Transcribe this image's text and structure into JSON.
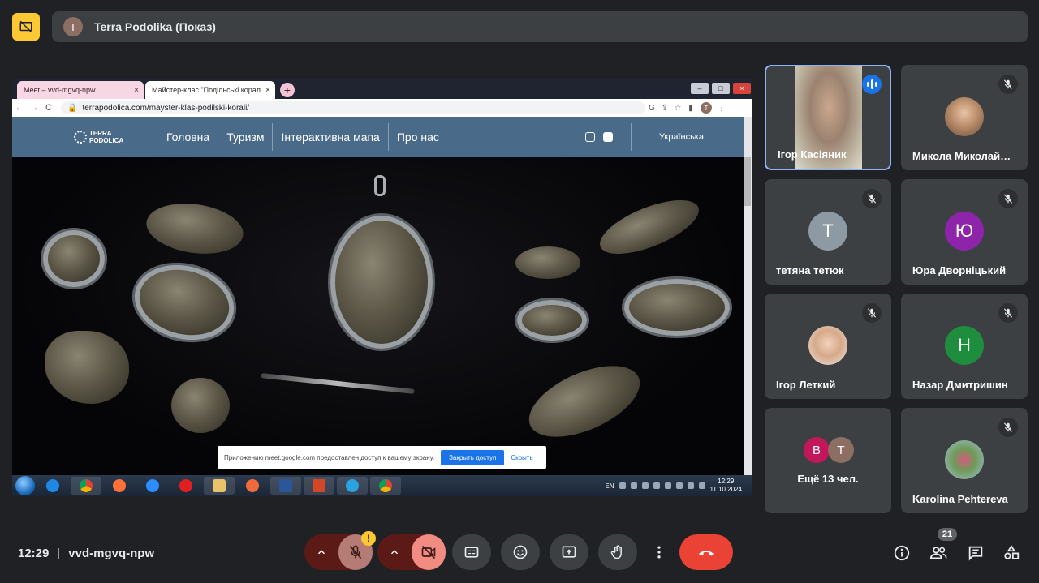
{
  "presenter_bar": {
    "avatar_letter": "T",
    "title": "Terra Podolika (Показ)"
  },
  "shared_screen": {
    "tabs": [
      {
        "label": "Meet – vvd-mgvq-npw",
        "close": "×"
      },
      {
        "label": "Майстер-клас \"Подільські корал",
        "close": "×"
      }
    ],
    "new_tab": "+",
    "window_controls": [
      "–",
      "□",
      "×"
    ],
    "nav_back": "←",
    "nav_forward": "→",
    "nav_reload": "C",
    "url": "terrapodolica.com/mayster-klas-podilski-korali/",
    "profile_letter": "T",
    "site": {
      "logo_line1": "TERRA",
      "logo_line2": "PODOLICA",
      "nav": [
        "Головна",
        "Туризм",
        "Інтерактивна мапа",
        "Про нас"
      ],
      "language": "Українська"
    },
    "share_notice": {
      "text": "Приложению meet.google.com предоставлен доступ к вашему экрану.",
      "stop_button": "Закрыть доступ",
      "hide_link": "Скрыть"
    },
    "taskbar": {
      "lang": "EN",
      "time": "12:29",
      "date": "11.10.2024"
    }
  },
  "participants": [
    {
      "name": "Ігор Касіяник",
      "speaking": true
    },
    {
      "name": "Микола Миколай…",
      "muted": true
    },
    {
      "name": "тетяна тетюк",
      "letter": "T",
      "color": "#8e9aa3",
      "muted": true
    },
    {
      "name": "Юра Дворніцький",
      "letter": "Ю",
      "color": "#8e24aa",
      "muted": true
    },
    {
      "name": "Ігор Леткий",
      "muted": true
    },
    {
      "name": "Назар Дмитришин",
      "letter": "Н",
      "color": "#1e8e3e",
      "muted": true
    },
    {
      "name": "Ещё 13 чел.",
      "letters": [
        "B",
        "T"
      ]
    },
    {
      "name": "Karolina Pehtereva",
      "muted": true
    }
  ],
  "meeting": {
    "time": "12:29",
    "separator": "|",
    "code": "vvd-mgvq-npw",
    "warning": "!",
    "people_count": "21"
  },
  "colors": {
    "background": "#202124",
    "tile": "#3c4043",
    "accent_blue": "#1a73e8",
    "end_call": "#ea4335",
    "present_yellow": "#fcc934"
  }
}
